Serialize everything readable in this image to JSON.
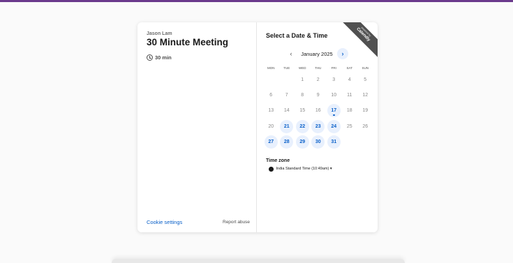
{
  "colors": {
    "accent": "#0a60c9",
    "available_bg": "#e8f0fd",
    "top_bar": "#6b3a8c",
    "ribbon": "#505050"
  },
  "event": {
    "host_name": "Jason Lam",
    "title": "30 Minute Meeting",
    "duration_icon": "clock-icon",
    "duration": "30 min"
  },
  "footer": {
    "cookie_settings": "Cookie settings",
    "report_abuse": "Report abuse"
  },
  "ribbon": {
    "line1": "powered by",
    "line2": "Calendly"
  },
  "calendar": {
    "heading": "Select a Date & Time",
    "month_label": "January 2025",
    "prev_icon": "chevron-left-icon",
    "next_icon": "chevron-right-icon",
    "prev_glyph": "‹",
    "next_glyph": "›",
    "weekdays": [
      "MON",
      "TUE",
      "WED",
      "THU",
      "FRI",
      "SAT",
      "SUN"
    ],
    "days": [
      {
        "d": ""
      },
      {
        "d": ""
      },
      {
        "d": "1"
      },
      {
        "d": "2"
      },
      {
        "d": "3"
      },
      {
        "d": "4"
      },
      {
        "d": "5"
      },
      {
        "d": "6"
      },
      {
        "d": "7"
      },
      {
        "d": "8"
      },
      {
        "d": "9"
      },
      {
        "d": "10"
      },
      {
        "d": "11"
      },
      {
        "d": "12"
      },
      {
        "d": "13"
      },
      {
        "d": "14"
      },
      {
        "d": "15"
      },
      {
        "d": "16"
      },
      {
        "d": "17",
        "available": true,
        "today": true
      },
      {
        "d": "18"
      },
      {
        "d": "19"
      },
      {
        "d": "20"
      },
      {
        "d": "21",
        "available": true
      },
      {
        "d": "22",
        "available": true
      },
      {
        "d": "23",
        "available": true
      },
      {
        "d": "24",
        "available": true
      },
      {
        "d": "25"
      },
      {
        "d": "26"
      },
      {
        "d": "27",
        "available": true
      },
      {
        "d": "28",
        "available": true
      },
      {
        "d": "29",
        "available": true
      },
      {
        "d": "30",
        "available": true
      },
      {
        "d": "31",
        "available": true
      }
    ]
  },
  "timezone": {
    "label": "Time zone",
    "icon": "globe-icon",
    "value": "India Standard Time (10:49am) ▾"
  }
}
